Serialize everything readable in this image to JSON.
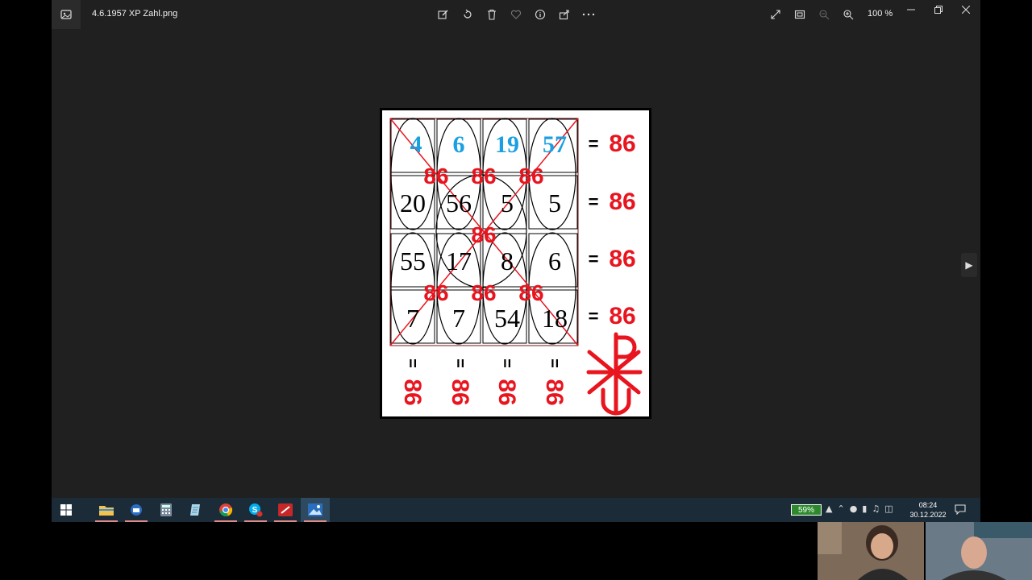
{
  "titlebar": {
    "filename": "4.6.1957 XP Zahl.png",
    "zoom": "100 %",
    "toolbar_icons": [
      "edit-icon",
      "rotate-icon",
      "delete-icon",
      "favorite-icon",
      "info-icon",
      "share-icon",
      "more-icon"
    ],
    "window_icons": [
      "fullscreen-icon",
      "fit-icon",
      "zoom-out-icon",
      "zoom-in-icon"
    ],
    "window_controls": [
      "minimize-icon",
      "restore-icon",
      "close-icon"
    ]
  },
  "image": {
    "top_row": [
      "4",
      "6",
      "19",
      "57"
    ],
    "rows": [
      [
        "20",
        "56",
        "5",
        "5"
      ],
      [
        "55",
        "17",
        "8",
        "6"
      ],
      [
        "7",
        "7",
        "54",
        "18"
      ]
    ],
    "row_sums": [
      "86",
      "86",
      "86",
      "86"
    ],
    "equals": "=",
    "overlay_upper": [
      "86",
      "86",
      "86"
    ],
    "overlay_center": "86",
    "overlay_lower": [
      "86",
      "86",
      "86"
    ],
    "column_equals": "=",
    "column_sums": [
      "86",
      "86",
      "86",
      "86"
    ],
    "colors": {
      "blue": "#1aa0e0",
      "red": "#e8141e",
      "black": "#000000"
    }
  },
  "taskbar": {
    "apps": [
      "windows-start-icon",
      "file-explorer-icon",
      "thunderbird-icon",
      "calculator-icon",
      "notepad-icon",
      "chrome-icon",
      "skype-icon",
      "pdf-icon",
      "photos-icon"
    ],
    "battery": "59%",
    "time": "08:24",
    "date": "30.12.2022"
  }
}
